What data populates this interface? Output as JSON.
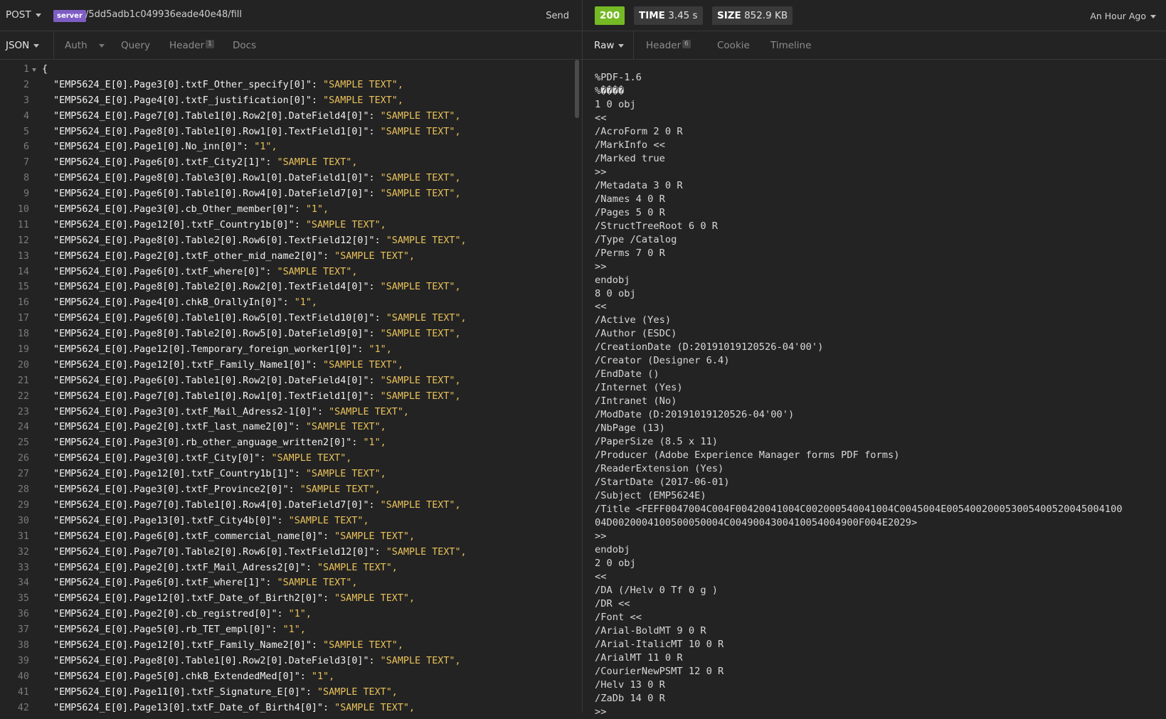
{
  "request": {
    "method": "POST",
    "server_badge": "server",
    "url_path": "/5dd5adb1c049936eade40e48/fill",
    "send_label": "Send",
    "tabs": [
      {
        "label": "JSON"
      },
      {
        "label": "Auth"
      },
      {
        "label": "Query"
      },
      {
        "label": "Header",
        "count": "1"
      },
      {
        "label": "Docs"
      }
    ],
    "body_lines": [
      {
        "n": "1",
        "key": "{",
        "val": ""
      },
      {
        "n": "2",
        "key": "  \"EMP5624_E[0].Page3[0].txtF_Other_specify[0]\": ",
        "val": "\"SAMPLE TEXT\","
      },
      {
        "n": "3",
        "key": "  \"EMP5624_E[0].Page4[0].txtF_justification[0]\": ",
        "val": "\"SAMPLE TEXT\","
      },
      {
        "n": "4",
        "key": "  \"EMP5624_E[0].Page7[0].Table1[0].Row2[0].DateField4[0]\": ",
        "val": "\"SAMPLE TEXT\","
      },
      {
        "n": "5",
        "key": "  \"EMP5624_E[0].Page8[0].Table1[0].Row1[0].TextField1[0]\": ",
        "val": "\"SAMPLE TEXT\","
      },
      {
        "n": "6",
        "key": "  \"EMP5624_E[0].Page1[0].No_inn[0]\": ",
        "val": "\"1\","
      },
      {
        "n": "7",
        "key": "  \"EMP5624_E[0].Page6[0].txtF_City2[1]\": ",
        "val": "\"SAMPLE TEXT\","
      },
      {
        "n": "8",
        "key": "  \"EMP5624_E[0].Page8[0].Table3[0].Row1[0].DateField1[0]\": ",
        "val": "\"SAMPLE TEXT\","
      },
      {
        "n": "9",
        "key": "  \"EMP5624_E[0].Page6[0].Table1[0].Row4[0].DateField7[0]\": ",
        "val": "\"SAMPLE TEXT\","
      },
      {
        "n": "10",
        "key": "  \"EMP5624_E[0].Page3[0].cb_Other_member[0]\": ",
        "val": "\"1\","
      },
      {
        "n": "11",
        "key": "  \"EMP5624_E[0].Page12[0].txtF_Country1b[0]\": ",
        "val": "\"SAMPLE TEXT\","
      },
      {
        "n": "12",
        "key": "  \"EMP5624_E[0].Page8[0].Table2[0].Row6[0].TextField12[0]\": ",
        "val": "\"SAMPLE TEXT\","
      },
      {
        "n": "13",
        "key": "  \"EMP5624_E[0].Page2[0].txtF_other_mid_name2[0]\": ",
        "val": "\"SAMPLE TEXT\","
      },
      {
        "n": "14",
        "key": "  \"EMP5624_E[0].Page6[0].txtF_where[0]\": ",
        "val": "\"SAMPLE TEXT\","
      },
      {
        "n": "15",
        "key": "  \"EMP5624_E[0].Page8[0].Table2[0].Row2[0].TextField4[0]\": ",
        "val": "\"SAMPLE TEXT\","
      },
      {
        "n": "16",
        "key": "  \"EMP5624_E[0].Page4[0].chkB_OrallyIn[0]\": ",
        "val": "\"1\","
      },
      {
        "n": "17",
        "key": "  \"EMP5624_E[0].Page6[0].Table1[0].Row5[0].TextField10[0]\": ",
        "val": "\"SAMPLE TEXT\","
      },
      {
        "n": "18",
        "key": "  \"EMP5624_E[0].Page8[0].Table2[0].Row5[0].DateField9[0]\": ",
        "val": "\"SAMPLE TEXT\","
      },
      {
        "n": "19",
        "key": "  \"EMP5624_E[0].Page12[0].Temporary_foreign_worker1[0]\": ",
        "val": "\"1\","
      },
      {
        "n": "20",
        "key": "  \"EMP5624_E[0].Page12[0].txtF_Family_Name1[0]\": ",
        "val": "\"SAMPLE TEXT\","
      },
      {
        "n": "21",
        "key": "  \"EMP5624_E[0].Page6[0].Table1[0].Row2[0].DateField4[0]\": ",
        "val": "\"SAMPLE TEXT\","
      },
      {
        "n": "22",
        "key": "  \"EMP5624_E[0].Page7[0].Table1[0].Row1[0].TextField1[0]\": ",
        "val": "\"SAMPLE TEXT\","
      },
      {
        "n": "23",
        "key": "  \"EMP5624_E[0].Page3[0].txtF_Mail_Adress2-1[0]\": ",
        "val": "\"SAMPLE TEXT\","
      },
      {
        "n": "24",
        "key": "  \"EMP5624_E[0].Page2[0].txtF_last_name2[0]\": ",
        "val": "\"SAMPLE TEXT\","
      },
      {
        "n": "25",
        "key": "  \"EMP5624_E[0].Page3[0].rb_other_anguage_written2[0]\": ",
        "val": "\"1\","
      },
      {
        "n": "26",
        "key": "  \"EMP5624_E[0].Page3[0].txtF_City[0]\": ",
        "val": "\"SAMPLE TEXT\","
      },
      {
        "n": "27",
        "key": "  \"EMP5624_E[0].Page12[0].txtF_Country1b[1]\": ",
        "val": "\"SAMPLE TEXT\","
      },
      {
        "n": "28",
        "key": "  \"EMP5624_E[0].Page3[0].txtF_Province2[0]\": ",
        "val": "\"SAMPLE TEXT\","
      },
      {
        "n": "29",
        "key": "  \"EMP5624_E[0].Page7[0].Table1[0].Row4[0].DateField7[0]\": ",
        "val": "\"SAMPLE TEXT\","
      },
      {
        "n": "30",
        "key": "  \"EMP5624_E[0].Page13[0].txtF_City4b[0]\": ",
        "val": "\"SAMPLE TEXT\","
      },
      {
        "n": "31",
        "key": "  \"EMP5624_E[0].Page6[0].txtF_commercial_name[0]\": ",
        "val": "\"SAMPLE TEXT\","
      },
      {
        "n": "32",
        "key": "  \"EMP5624_E[0].Page7[0].Table2[0].Row6[0].TextField12[0]\": ",
        "val": "\"SAMPLE TEXT\","
      },
      {
        "n": "33",
        "key": "  \"EMP5624_E[0].Page2[0].txtF_Mail_Adress2[0]\": ",
        "val": "\"SAMPLE TEXT\","
      },
      {
        "n": "34",
        "key": "  \"EMP5624_E[0].Page6[0].txtF_where[1]\": ",
        "val": "\"SAMPLE TEXT\","
      },
      {
        "n": "35",
        "key": "  \"EMP5624_E[0].Page12[0].txtF_Date_of_Birth2[0]\": ",
        "val": "\"SAMPLE TEXT\","
      },
      {
        "n": "36",
        "key": "  \"EMP5624_E[0].Page2[0].cb_registred[0]\": ",
        "val": "\"1\","
      },
      {
        "n": "37",
        "key": "  \"EMP5624_E[0].Page5[0].rb_TET_empl[0]\": ",
        "val": "\"1\","
      },
      {
        "n": "38",
        "key": "  \"EMP5624_E[0].Page12[0].txtF_Family_Name2[0]\": ",
        "val": "\"SAMPLE TEXT\","
      },
      {
        "n": "39",
        "key": "  \"EMP5624_E[0].Page8[0].Table1[0].Row2[0].DateField3[0]\": ",
        "val": "\"SAMPLE TEXT\","
      },
      {
        "n": "40",
        "key": "  \"EMP5624_E[0].Page5[0].chkB_ExtendedMed[0]\": ",
        "val": "\"1\","
      },
      {
        "n": "41",
        "key": "  \"EMP5624_E[0].Page11[0].txtF_Signature_E[0]\": ",
        "val": "\"SAMPLE TEXT\","
      },
      {
        "n": "42",
        "key": "  \"EMP5624_E[0].Page13[0].txtF_Date_of_Birth4[0]\": ",
        "val": "\"SAMPLE TEXT\","
      }
    ]
  },
  "response": {
    "status": "200",
    "time_label": "TIME",
    "time_value": "3.45 s",
    "size_label": "SIZE",
    "size_value": "852.9 KB",
    "history_label": "An Hour Ago",
    "tabs": [
      {
        "label": "Raw"
      },
      {
        "label": "Header",
        "count": "6"
      },
      {
        "label": "Cookie"
      },
      {
        "label": "Timeline"
      }
    ],
    "raw_lines": [
      "%PDF-1.6",
      "%����",
      "1 0 obj",
      "<<",
      "/AcroForm 2 0 R",
      "/MarkInfo <<",
      "/Marked true",
      ">>",
      "/Metadata 3 0 R",
      "/Names 4 0 R",
      "/Pages 5 0 R",
      "/StructTreeRoot 6 0 R",
      "/Type /Catalog",
      "/Perms 7 0 R",
      ">>",
      "endobj",
      "8 0 obj",
      "<<",
      "/Active (Yes)",
      "/Author (ESDC)",
      "/CreationDate (D:20191019120526-04'00')",
      "/Creator (Designer 6.4)",
      "/EndDate ()",
      "/Internet (Yes)",
      "/Intranet (No)",
      "/ModDate (D:20191019120526-04'00')",
      "/NbPage (13)",
      "/PaperSize (8.5 x 11)",
      "/Producer (Adobe Experience Manager forms PDF forms)",
      "/ReaderExtension (Yes)",
      "/StartDate (2017-06-01)",
      "/Subject (EMP5624E)",
      "/Title <FEFF0047004C004F00420041004C002000540041004C0045004E005400200053005400520045004100",
      "04D0020004100500050004C0049004300410054004900F004E2029>",
      ">>",
      "endobj",
      "2 0 obj",
      "<<",
      "/DA (/Helv 0 Tf 0 g )",
      "/DR <<",
      "/Font <<",
      "/Arial-BoldMT 9 0 R",
      "/Arial-ItalicMT 10 0 R",
      "/ArialMT 11 0 R",
      "/CourierNewPSMT 12 0 R",
      "/Helv 13 0 R",
      "/ZaDb 14 0 R",
      ">>"
    ]
  }
}
